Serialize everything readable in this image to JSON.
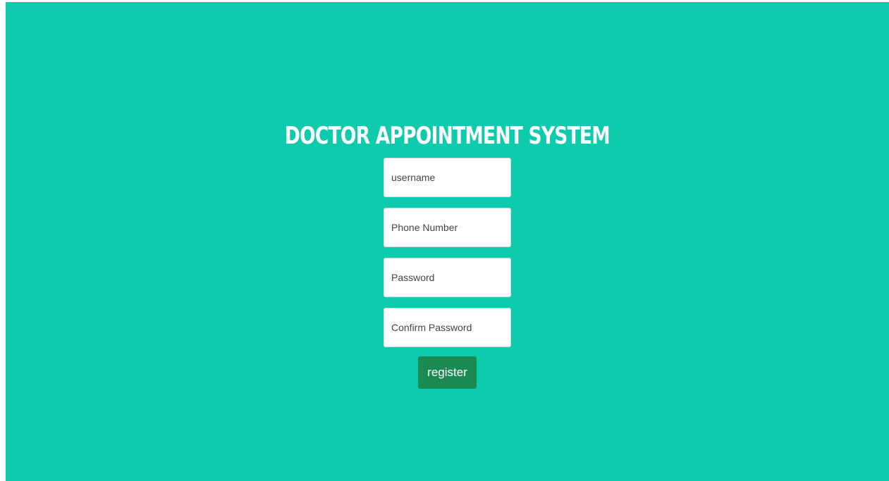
{
  "page": {
    "title": "DOCTOR APPOINTMENT SYSTEM",
    "background_color": "#0fcbad"
  },
  "form": {
    "username_placeholder": "username",
    "phone_placeholder": "Phone Number",
    "password_placeholder": "Password",
    "confirm_password_placeholder": "Confirm Password",
    "register_label": "register",
    "register_color": "#1a8a52"
  }
}
